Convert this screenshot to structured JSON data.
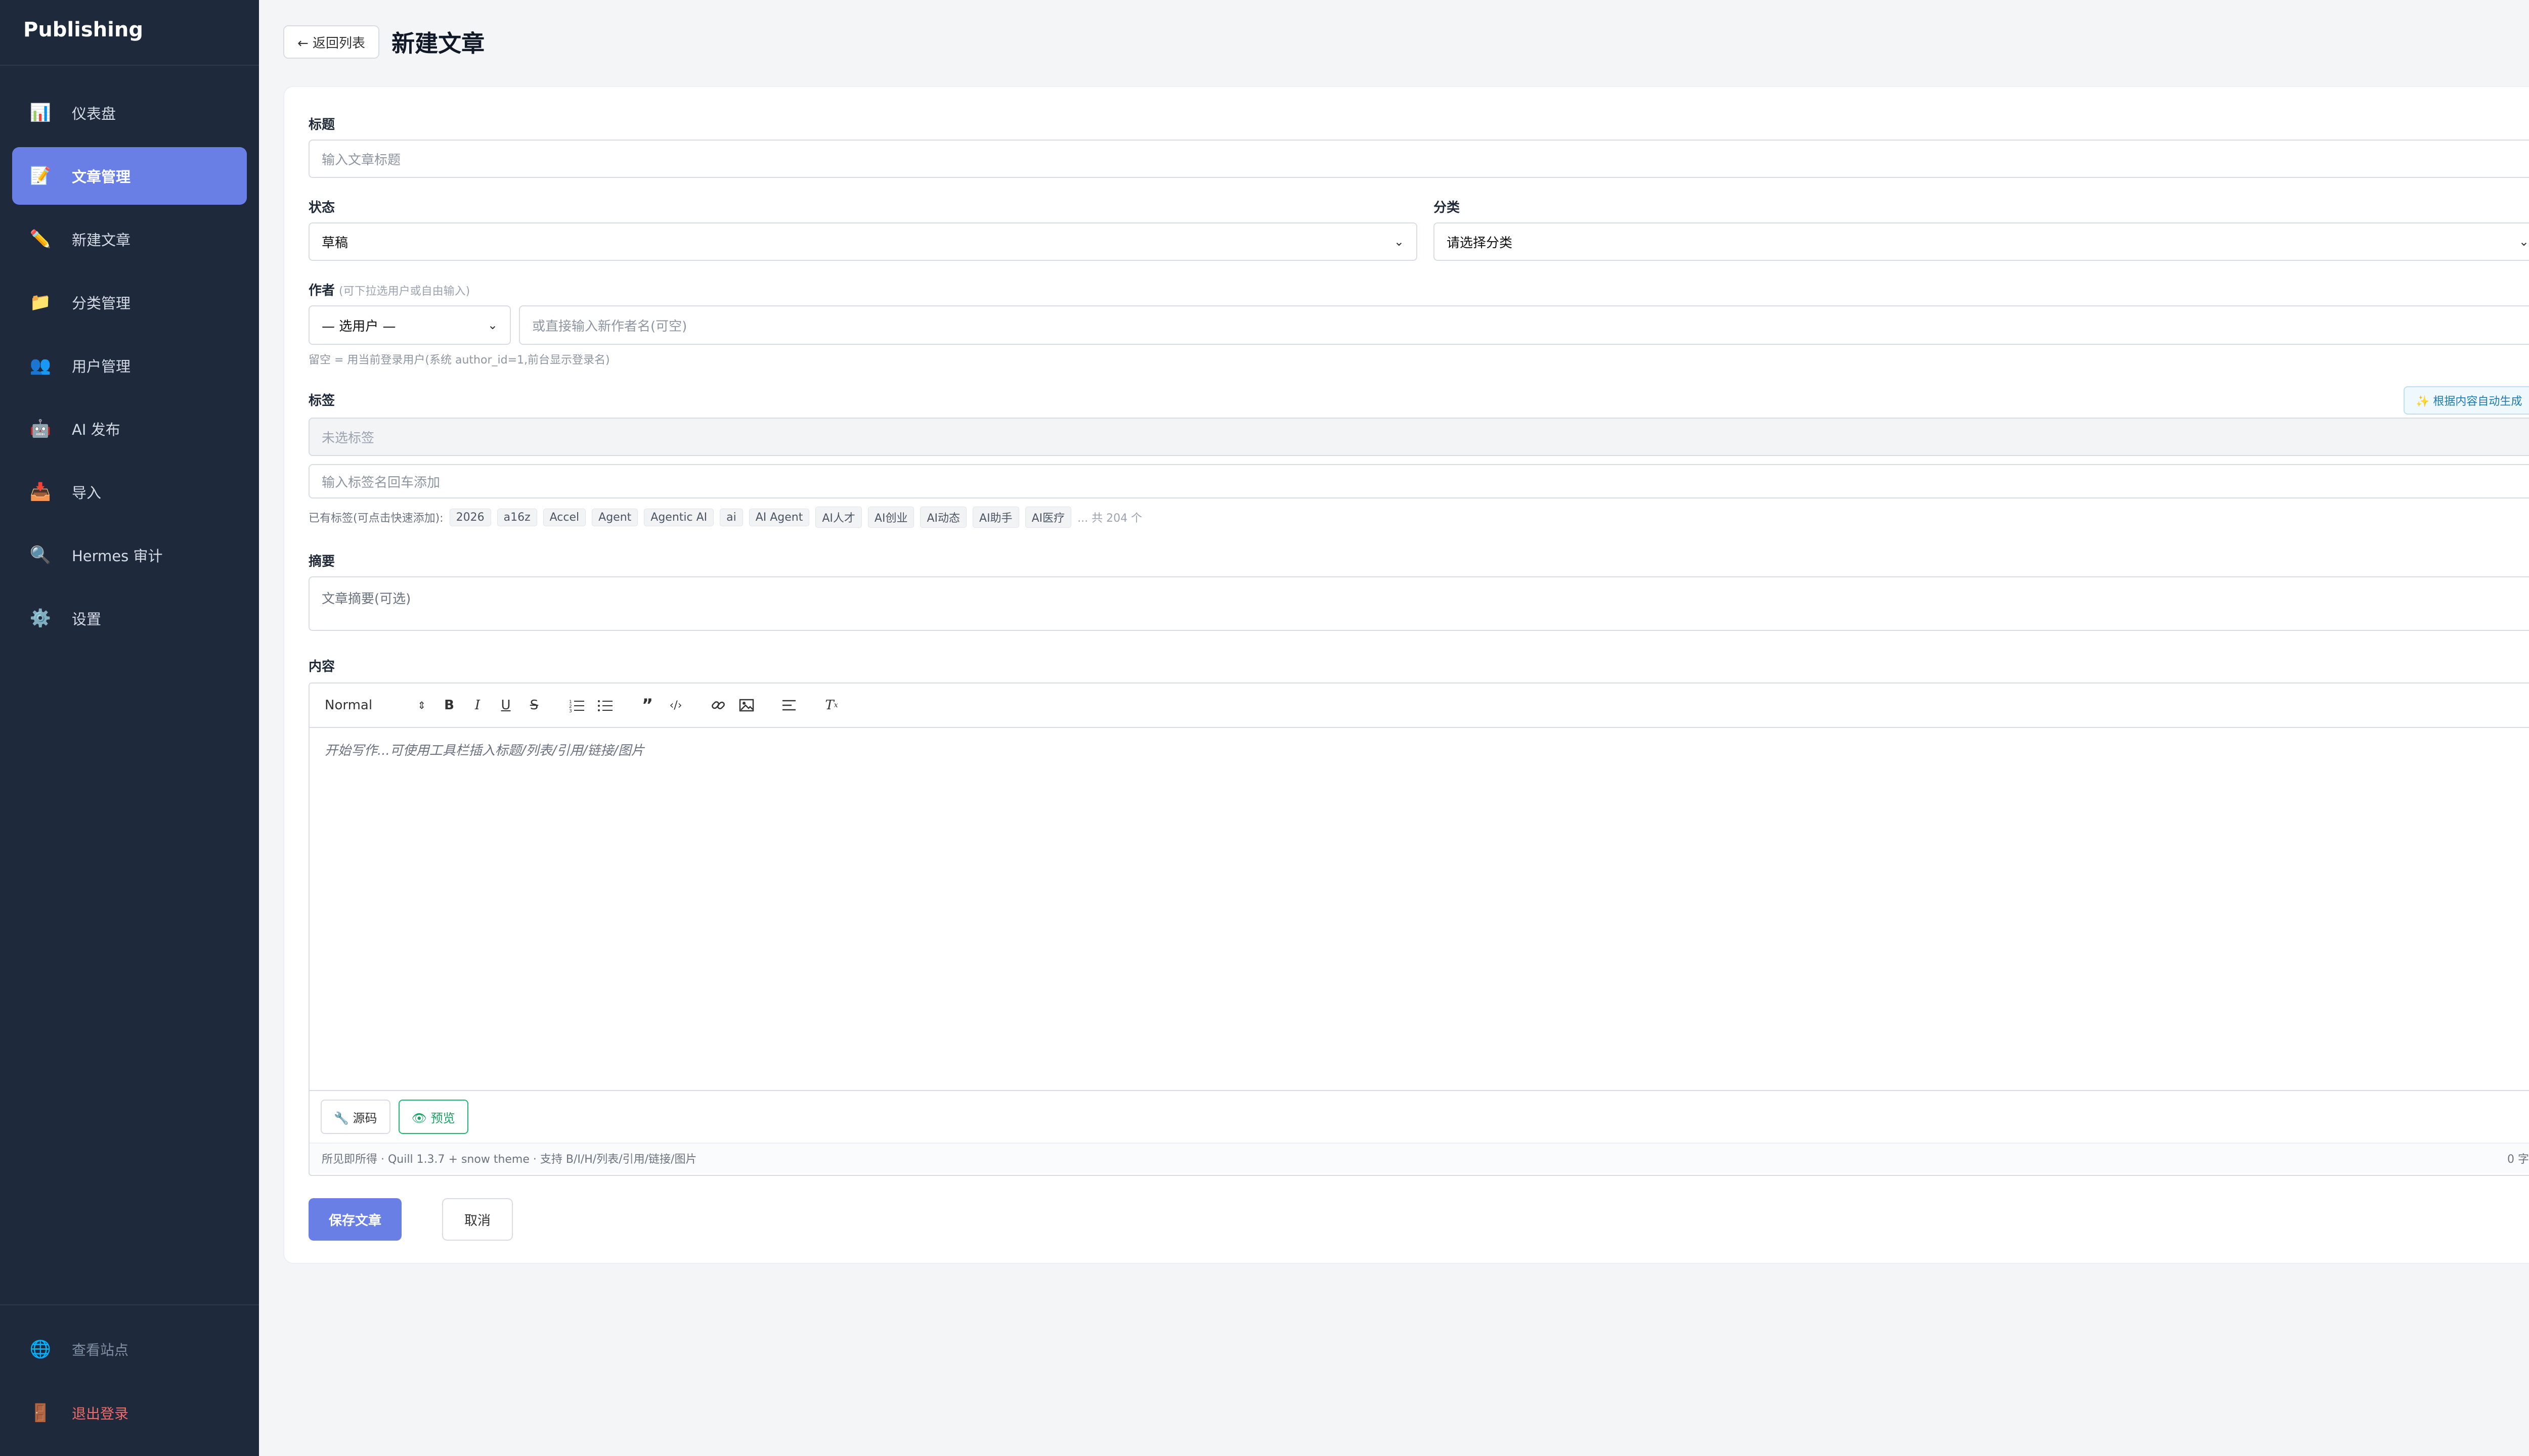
{
  "sidebar": {
    "brand": "Publishing",
    "items": [
      {
        "label": "仪表盘",
        "icon": "bar-chart-icon",
        "glyph": "📊"
      },
      {
        "label": "文章管理",
        "icon": "memo-icon",
        "glyph": "📝"
      },
      {
        "label": "新建文章",
        "icon": "pencil-icon",
        "glyph": "✏️"
      },
      {
        "label": "分类管理",
        "icon": "folder-icon",
        "glyph": "📁"
      },
      {
        "label": "用户管理",
        "icon": "users-icon",
        "glyph": "👥"
      },
      {
        "label": "AI 发布",
        "icon": "robot-icon",
        "glyph": "🤖"
      },
      {
        "label": "导入",
        "icon": "inbox-tray-icon",
        "glyph": "📥"
      },
      {
        "label": "Hermes 审计",
        "icon": "magnifier-icon",
        "glyph": "🔍"
      },
      {
        "label": "设置",
        "icon": "gear-icon",
        "glyph": "⚙️"
      }
    ],
    "active_index": 1,
    "footer": [
      {
        "label": "查看站点",
        "icon": "globe-icon",
        "glyph": "🌐"
      },
      {
        "label": "退出登录",
        "icon": "door-icon",
        "glyph": "🚪"
      }
    ]
  },
  "header": {
    "back_label": "← 返回列表",
    "title": "新建文章"
  },
  "form": {
    "title_label": "标题",
    "title_placeholder": "输入文章标题",
    "status_label": "状态",
    "status_value": "草稿",
    "category_label": "分类",
    "category_value": "请选择分类",
    "author_label": "作者",
    "author_hint_inline": "(可下拉选用户或自由输入)",
    "author_select_value": "— 选用户 —",
    "author_input_placeholder": "或直接输入新作者名(可空)",
    "author_note": "留空 = 用当前登录用户(系统 author_id=1,前台显示登录名)",
    "tags_label": "标签",
    "auto_tag_button": "✨ 根据内容自动生成",
    "tags_selected_placeholder": "未选标签",
    "tag_input_placeholder": "输入标签名回车添加",
    "existing_tags_prefix": "已有标签(可点击快速添加):",
    "existing_tags": [
      "2026",
      "a16z",
      "Accel",
      "Agent",
      "Agentic AI",
      "ai",
      "AI Agent",
      "AI人才",
      "AI创业",
      "AI动态",
      "AI助手",
      "AI医疗"
    ],
    "existing_tags_more": "... 共 204 个",
    "summary_label": "摘要",
    "summary_placeholder": "文章摘要(可选)",
    "content_label": "内容",
    "editor": {
      "format_value": "Normal",
      "placeholder": "开始写作...可使用工具栏插入标题/列表/引用/链接/图片",
      "source_button": "🔧 源码",
      "preview_button": "👁 预览",
      "status_text": "所见即所得 · Quill 1.3.7 + snow theme · 支持 B/I/H/列表/引用/链接/图片",
      "word_count": "0 字"
    },
    "save_button": "保存文章",
    "cancel_button": "取消"
  }
}
